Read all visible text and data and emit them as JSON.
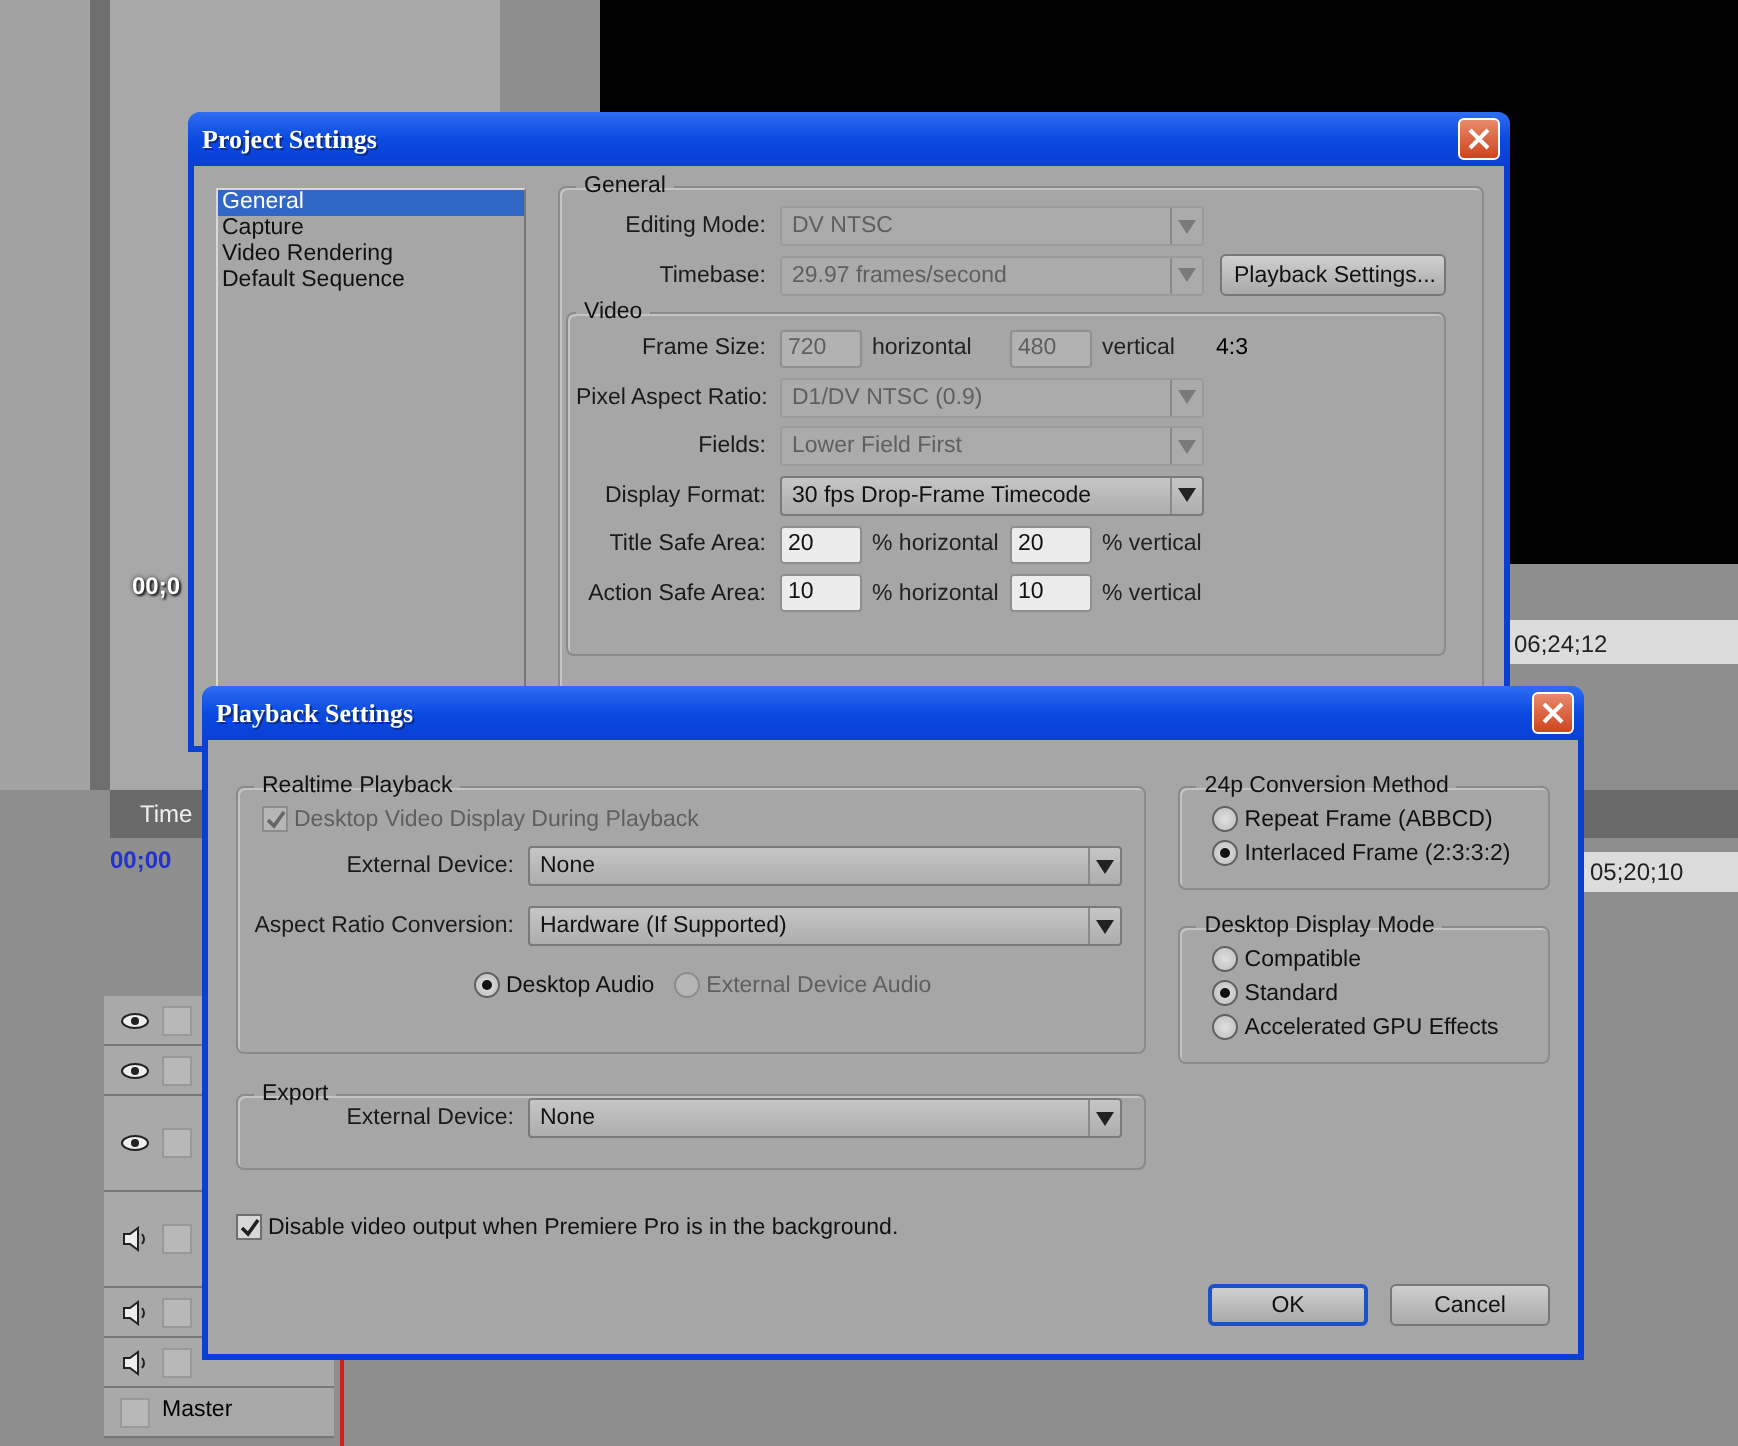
{
  "background": {
    "monitor_time": "00;0",
    "program_ruler_time": "06;24;12",
    "timeline_tab": "Time",
    "timeline_timecode": "00;00",
    "timeline_ruler_time": "05;20;10",
    "tracks": [
      {
        "kind": "video"
      },
      {
        "kind": "video"
      },
      {
        "kind": "video_expanded"
      },
      {
        "kind": "audio_expanded"
      },
      {
        "kind": "audio"
      },
      {
        "kind": "audio"
      }
    ],
    "master_track": "Master"
  },
  "project_settings": {
    "title": "Project Settings",
    "sections": [
      {
        "label": "General",
        "selected": true
      },
      {
        "label": "Capture",
        "selected": false
      },
      {
        "label": "Video Rendering",
        "selected": false
      },
      {
        "label": "Default Sequence",
        "selected": false
      }
    ],
    "general": {
      "legend": "General",
      "rows": [
        {
          "kind": "select",
          "label": "Editing Mode:",
          "value": "DV NTSC",
          "disabled": true
        },
        {
          "kind": "select",
          "label": "Timebase:",
          "value": "29.97 frames/second",
          "disabled": true
        }
      ],
      "playback_button": "Playback Settings...",
      "video": {
        "legend": "Video",
        "rows": [
          {
            "kind": "pair",
            "label": "Frame Size:",
            "disabled": true,
            "fields": [
              {
                "value": "720",
                "unit": "horizontal"
              },
              {
                "value": "480",
                "unit": "vertical"
              }
            ],
            "note": "4:3"
          },
          {
            "kind": "select",
            "label": "Pixel Aspect Ratio:",
            "value": "D1/DV NTSC (0.9)",
            "disabled": true
          },
          {
            "kind": "select",
            "label": "Fields:",
            "value": "Lower Field First",
            "disabled": true
          },
          {
            "kind": "select",
            "label": "Display Format:",
            "value": "30 fps Drop-Frame Timecode",
            "disabled": false
          },
          {
            "kind": "pair",
            "label": "Title Safe Area:",
            "disabled": false,
            "fields": [
              {
                "value": "20",
                "unit": "% horizontal"
              },
              {
                "value": "20",
                "unit": "% vertical"
              }
            ]
          },
          {
            "kind": "pair",
            "label": "Action Safe Area:",
            "disabled": false,
            "fields": [
              {
                "value": "10",
                "unit": "% horizontal"
              },
              {
                "value": "10",
                "unit": "% vertical"
              }
            ]
          }
        ]
      }
    }
  },
  "playback_settings": {
    "title": "Playback Settings",
    "realtime": {
      "legend": "Realtime Playback",
      "desktop_video": {
        "label": "Desktop Video Display During Playback",
        "checked": true,
        "disabled": true
      },
      "selects": [
        {
          "label": "External Device:",
          "value": "None"
        },
        {
          "label": "Aspect Ratio Conversion:",
          "value": "Hardware (If Supported)"
        }
      ],
      "audio": [
        {
          "label": "Desktop Audio",
          "selected": true,
          "disabled": false
        },
        {
          "label": "External Device Audio",
          "selected": false,
          "disabled": true
        }
      ]
    },
    "export": {
      "legend": "Export",
      "selects": [
        {
          "label": "External Device:",
          "value": "None"
        }
      ]
    },
    "disable_output": {
      "label": "Disable video output when Premiere Pro is in the background.",
      "checked": true
    },
    "conversion": {
      "legend": "24p Conversion Method",
      "options": [
        {
          "label": "Repeat Frame (ABBCD)",
          "selected": false
        },
        {
          "label": "Interlaced Frame (2:3:3:2)",
          "selected": true
        }
      ]
    },
    "display_mode": {
      "legend": "Desktop Display Mode",
      "options": [
        {
          "label": "Compatible",
          "selected": false
        },
        {
          "label": "Standard",
          "selected": true
        },
        {
          "label": "Accelerated GPU Effects",
          "selected": false
        }
      ]
    },
    "buttons": [
      {
        "label": "OK",
        "default": true
      },
      {
        "label": "Cancel",
        "default": false
      }
    ]
  }
}
